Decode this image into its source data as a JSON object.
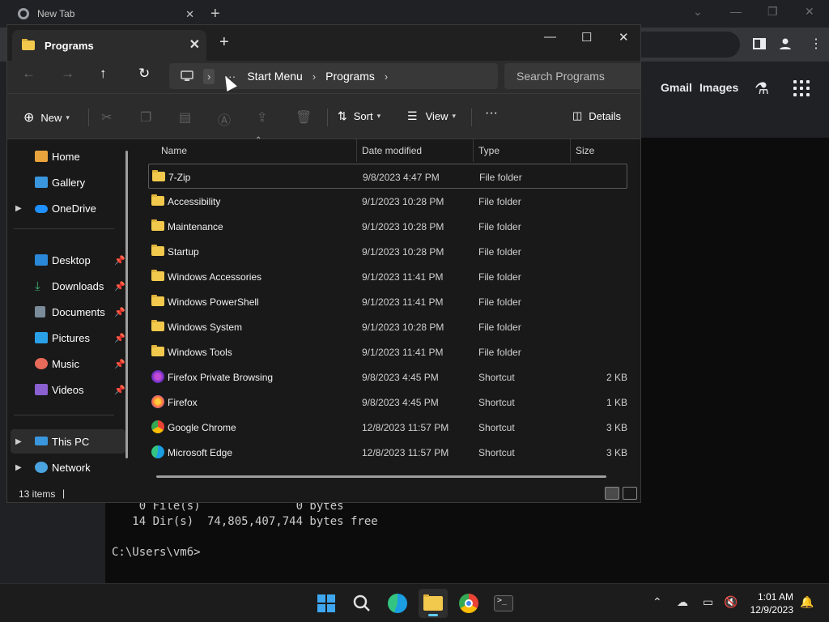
{
  "browser": {
    "tab_title": "New Tab",
    "links": {
      "gmail": "Gmail",
      "images": "Images"
    }
  },
  "terminal": {
    "line1": "    0 File(s)              0 bytes",
    "line2": "   14 Dir(s)  74,805,407,744 bytes free",
    "line3": "C:\\Users\\vm6>"
  },
  "explorer": {
    "tab_title": "Programs",
    "breadcrumbs": [
      "Start Menu",
      "Programs"
    ],
    "search_placeholder": "Search Programs",
    "commands": {
      "new": "New",
      "sort": "Sort",
      "view": "View",
      "details": "Details"
    },
    "sidebar": {
      "top": [
        {
          "label": "Home",
          "icon": "home-icon"
        },
        {
          "label": "Gallery",
          "icon": "gallery-icon"
        },
        {
          "label": "OneDrive",
          "icon": "onedrive-icon"
        }
      ],
      "pinned": [
        {
          "label": "Desktop",
          "icon": "desktop-icon"
        },
        {
          "label": "Downloads",
          "icon": "downloads-icon"
        },
        {
          "label": "Documents",
          "icon": "documents-icon"
        },
        {
          "label": "Pictures",
          "icon": "pictures-icon"
        },
        {
          "label": "Music",
          "icon": "music-icon"
        },
        {
          "label": "Videos",
          "icon": "videos-icon"
        }
      ],
      "bottom": [
        {
          "label": "This PC",
          "icon": "this-pc-icon"
        },
        {
          "label": "Network",
          "icon": "network-icon"
        }
      ]
    },
    "columns": {
      "name": "Name",
      "date": "Date modified",
      "type": "Type",
      "size": "Size"
    },
    "files": [
      {
        "name": "7-Zip",
        "date": "9/8/2023 4:47 PM",
        "type": "File folder",
        "size": ""
      },
      {
        "name": "Accessibility",
        "date": "9/1/2023 10:28 PM",
        "type": "File folder",
        "size": ""
      },
      {
        "name": "Maintenance",
        "date": "9/1/2023 10:28 PM",
        "type": "File folder",
        "size": ""
      },
      {
        "name": "Startup",
        "date": "9/1/2023 10:28 PM",
        "type": "File folder",
        "size": ""
      },
      {
        "name": "Windows Accessories",
        "date": "9/1/2023 11:41 PM",
        "type": "File folder",
        "size": ""
      },
      {
        "name": "Windows PowerShell",
        "date": "9/1/2023 11:41 PM",
        "type": "File folder",
        "size": ""
      },
      {
        "name": "Windows System",
        "date": "9/1/2023 10:28 PM",
        "type": "File folder",
        "size": ""
      },
      {
        "name": "Windows Tools",
        "date": "9/1/2023 11:41 PM",
        "type": "File folder",
        "size": ""
      },
      {
        "name": "Firefox Private Browsing",
        "date": "9/8/2023 4:45 PM",
        "type": "Shortcut",
        "size": "2 KB"
      },
      {
        "name": "Firefox",
        "date": "9/8/2023 4:45 PM",
        "type": "Shortcut",
        "size": "1 KB"
      },
      {
        "name": "Google Chrome",
        "date": "12/8/2023 11:57 PM",
        "type": "Shortcut",
        "size": "3 KB"
      },
      {
        "name": "Microsoft Edge",
        "date": "12/8/2023 11:57 PM",
        "type": "Shortcut",
        "size": "3 KB"
      }
    ],
    "status": {
      "item_count": "13 items"
    }
  },
  "taskbar": {
    "time": "1:01 AM",
    "date": "12/9/2023"
  },
  "colors": {
    "folder": "#f2c94c",
    "accent": "#60cdff",
    "explorer_bg": "#191919",
    "toolbar_bg": "#2c2c2c"
  }
}
